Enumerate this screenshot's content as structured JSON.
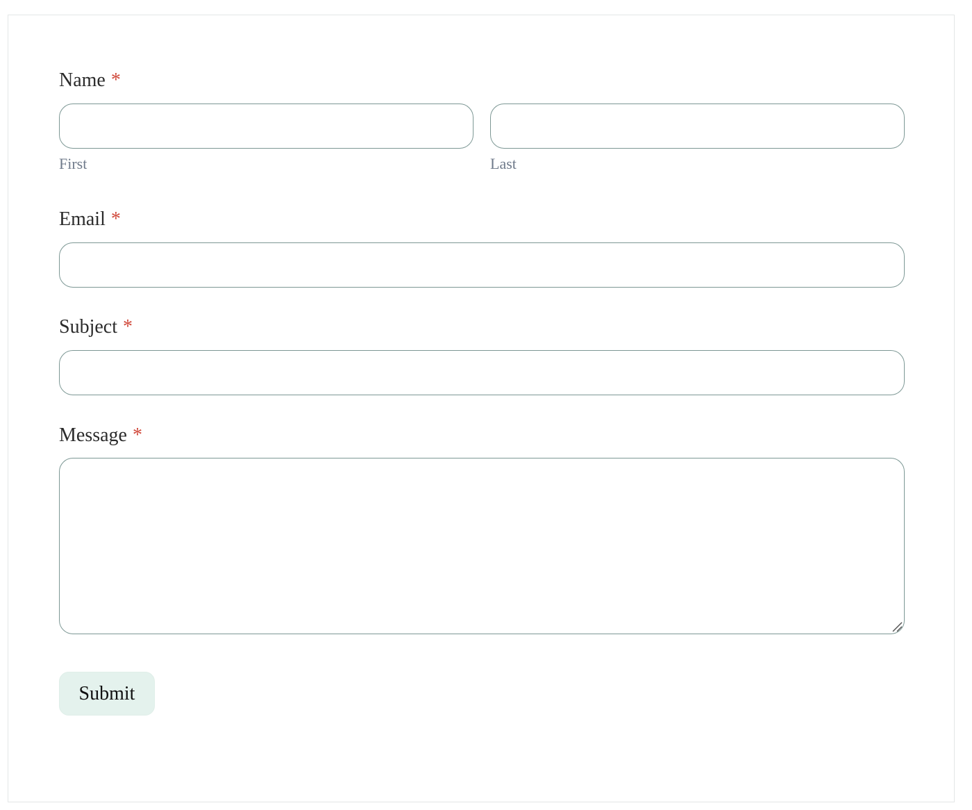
{
  "form": {
    "required_marker": "*",
    "name": {
      "label": "Name",
      "first_value": "",
      "last_value": "",
      "first_sublabel": "First",
      "last_sublabel": "Last"
    },
    "email": {
      "label": "Email",
      "value": ""
    },
    "subject": {
      "label": "Subject",
      "value": ""
    },
    "message": {
      "label": "Message",
      "value": ""
    },
    "submit_label": "Submit"
  },
  "colors": {
    "required": "#d0483a",
    "input_border": "#7c9794",
    "submit_bg": "#e4f2ed",
    "sublabel": "#6f7a8a"
  }
}
